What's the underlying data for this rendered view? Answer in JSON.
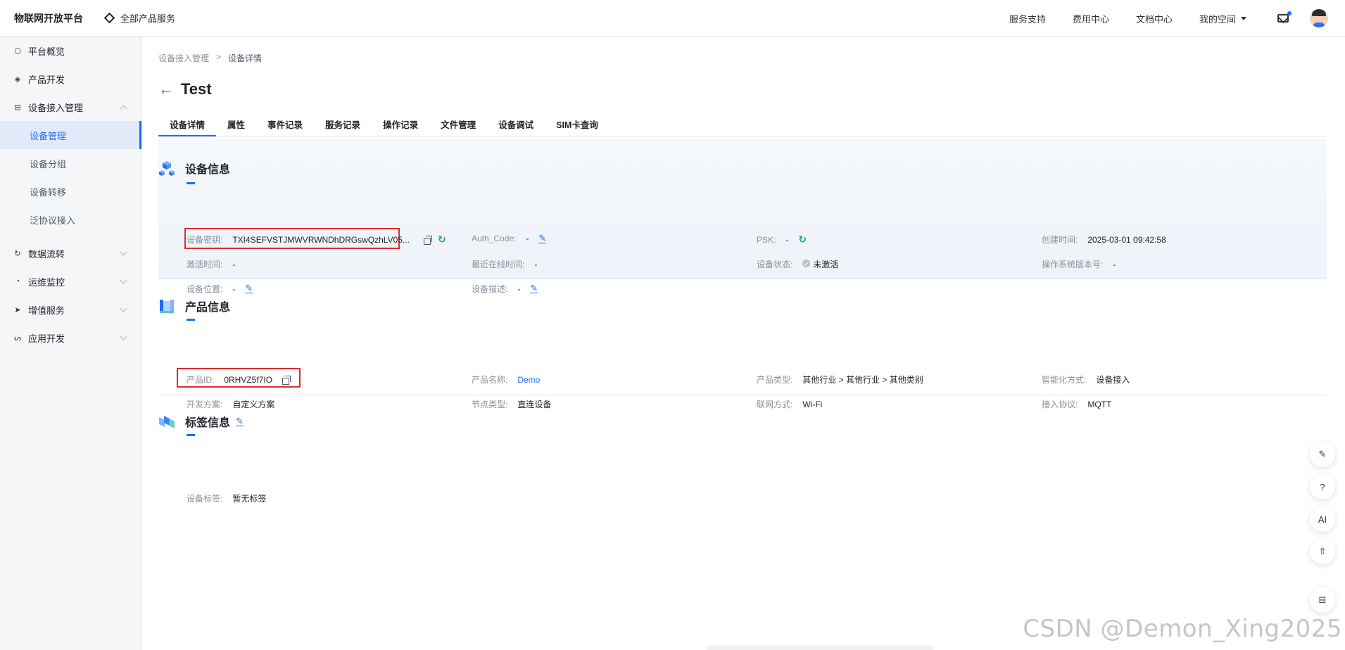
{
  "topbar": {
    "brand": "物联网开放平台",
    "all_products": "全部产品服务",
    "links": [
      "服务支持",
      "费用中心",
      "文档中心"
    ],
    "my_space": "我的空间"
  },
  "sidebar": {
    "items": [
      {
        "label": "平台概览",
        "icon": "overview-icon"
      },
      {
        "label": "产品开发",
        "icon": "cube-icon"
      },
      {
        "label": "设备接入管理",
        "icon": "device-icon"
      },
      {
        "label": "数据流转",
        "icon": "data-flow-icon"
      },
      {
        "label": "运维监控",
        "icon": "monitor-icon"
      },
      {
        "label": "增值服务",
        "icon": "send-icon"
      },
      {
        "label": "应用开发",
        "icon": "app-icon"
      }
    ],
    "sub_items": [
      "设备管理",
      "设备分组",
      "设备转移",
      "泛协议接入"
    ]
  },
  "breadcrumb": {
    "parent": "设备接入管理",
    "sep": ">",
    "current": "设备详情"
  },
  "page": {
    "title": "Test"
  },
  "tabs": [
    "设备详情",
    "属性",
    "事件记录",
    "服务记录",
    "操作记录",
    "文件管理",
    "设备调试",
    "SIM卡查询"
  ],
  "device_info": {
    "title": "设备信息",
    "fields": {
      "secret": {
        "label": "设备密钥:",
        "value": "TXI4SEFVSTJMWVRWNDhDRGswQzhLV05..."
      },
      "auth_code": {
        "label": "Auth_Code:",
        "value": "-"
      },
      "psk": {
        "label": "PSK:",
        "value": "-"
      },
      "created": {
        "label": "创建时间:",
        "value": "2025-03-01 09:42:58"
      },
      "activated": {
        "label": "激活时间:",
        "value": "-"
      },
      "last_online": {
        "label": "最近在线时间:",
        "value": "-"
      },
      "status": {
        "label": "设备状态:",
        "value": "未激活"
      },
      "os_version": {
        "label": "操作系统版本号:",
        "value": "-"
      },
      "location": {
        "label": "设备位置:",
        "value": "-"
      },
      "description": {
        "label": "设备描述:",
        "value": "-"
      }
    }
  },
  "product_info": {
    "title": "产品信息",
    "fields": {
      "product_id": {
        "label": "产品ID:",
        "value": "0RHVZ5f7IO"
      },
      "product_name": {
        "label": "产品名称:",
        "value": "Demo"
      },
      "product_type": {
        "label": "产品类型:",
        "value": "其他行业 > 其他行业 > 其他类别"
      },
      "smart_mode": {
        "label": "智能化方式:",
        "value": "设备接入"
      },
      "dev_plan": {
        "label": "开发方案:",
        "value": "自定义方案"
      },
      "node_type": {
        "label": "节点类型:",
        "value": "直连设备"
      },
      "network": {
        "label": "联网方式:",
        "value": "Wi-Fi"
      },
      "protocol": {
        "label": "接入协议:",
        "value": "MQTT"
      }
    }
  },
  "tag_info": {
    "title": "标签信息",
    "fields": {
      "tags": {
        "label": "设备标签:",
        "value": "暂无标签"
      }
    }
  },
  "float_buttons": {
    "ai": "AI"
  },
  "watermark": "CSDN @Demon_Xing2025",
  "colors": {
    "accent": "#1d6cf5",
    "highlight_box": "#e32b2b",
    "refresh": "#23a455"
  }
}
